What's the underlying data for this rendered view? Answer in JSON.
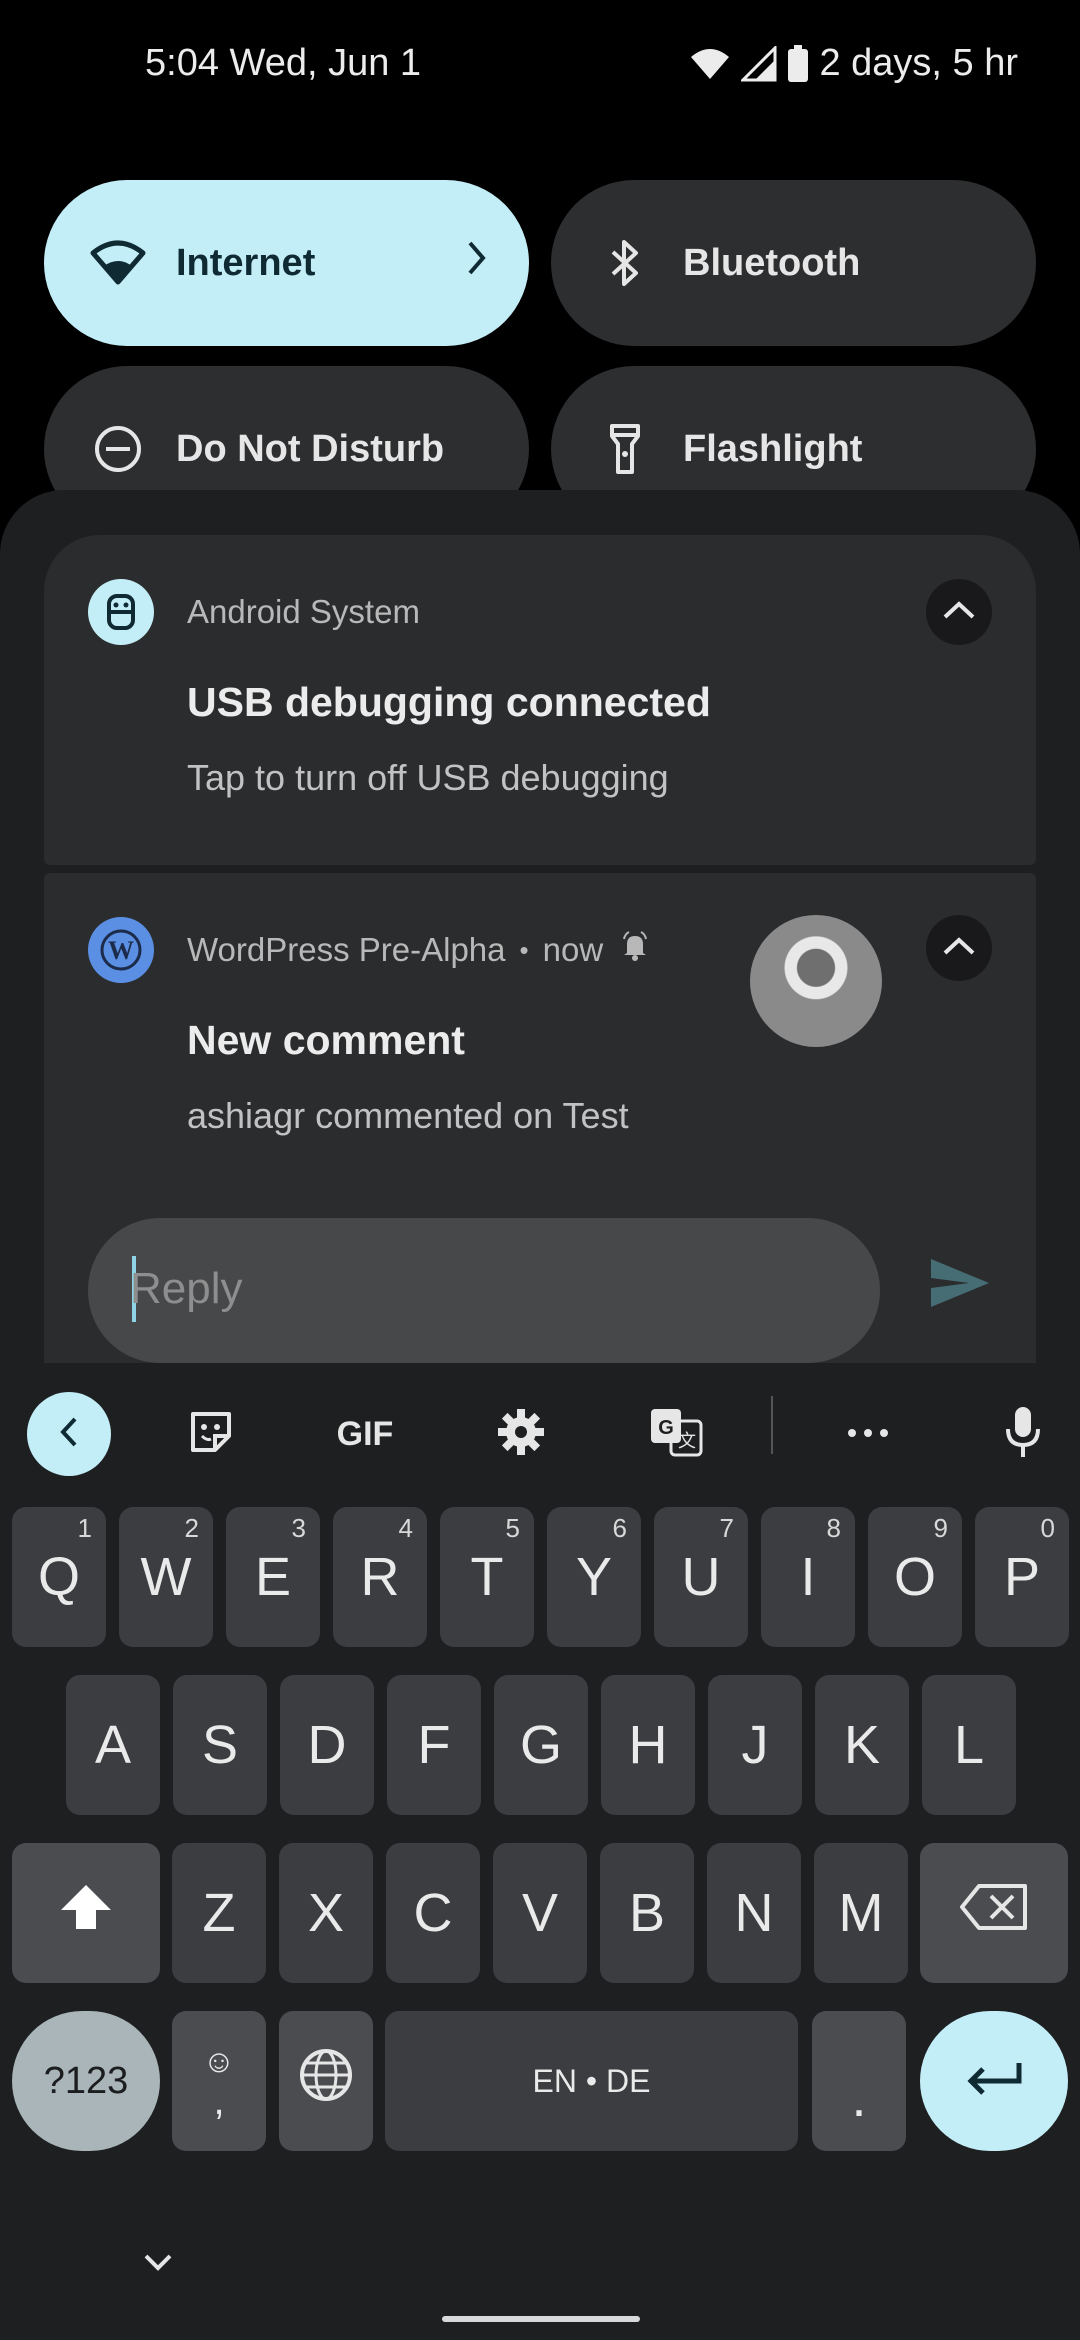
{
  "status_bar": {
    "time_date": "5:04 Wed, Jun 1",
    "battery_text": "2 days, 5 hr",
    "icons": [
      "wifi-icon",
      "signal-icon",
      "battery-icon"
    ]
  },
  "quick_tiles": [
    {
      "label": "Internet",
      "icon": "wifi-icon",
      "active": true
    },
    {
      "label": "Bluetooth",
      "icon": "bluetooth-icon",
      "active": false
    },
    {
      "label": "Do Not Disturb",
      "icon": "dnd-icon",
      "active": false
    },
    {
      "label": "Flashlight",
      "icon": "flashlight-icon",
      "active": false
    }
  ],
  "notifications": [
    {
      "app": "Android System",
      "title": "USB debugging connected",
      "text": "Tap to turn off USB debugging",
      "icon": "android-system-icon"
    },
    {
      "app": "WordPress Pre-Alpha",
      "separator": "•",
      "time": "now",
      "title": "New comment",
      "text": "ashiagr commented on Test",
      "icon": "wordpress-icon",
      "reply_placeholder": "Reply"
    }
  ],
  "keyboard": {
    "toolbar": [
      "back-icon",
      "sticker-icon",
      "GIF",
      "settings-icon",
      "translate-icon",
      "more-icon",
      "mic-icon"
    ],
    "gif_label": "GIF",
    "more_label": "•••",
    "row1": [
      {
        "k": "Q",
        "h": "1"
      },
      {
        "k": "W",
        "h": "2"
      },
      {
        "k": "E",
        "h": "3"
      },
      {
        "k": "R",
        "h": "4"
      },
      {
        "k": "T",
        "h": "5"
      },
      {
        "k": "Y",
        "h": "6"
      },
      {
        "k": "U",
        "h": "7"
      },
      {
        "k": "I",
        "h": "8"
      },
      {
        "k": "O",
        "h": "9"
      },
      {
        "k": "P",
        "h": "0"
      }
    ],
    "row2": [
      "A",
      "S",
      "D",
      "F",
      "G",
      "H",
      "J",
      "K",
      "L"
    ],
    "row3": [
      "Z",
      "X",
      "C",
      "V",
      "B",
      "N",
      "M"
    ],
    "symbols_label": "?123",
    "emoji_label": "☺",
    "comma_label": ",",
    "space_label": "EN • DE",
    "period_label": "."
  },
  "colors": {
    "accent": "#c4eef7",
    "tile_dark": "#2d2e30",
    "card": "#2b2c2e",
    "wordpress_blue": "#5a8fe3"
  }
}
